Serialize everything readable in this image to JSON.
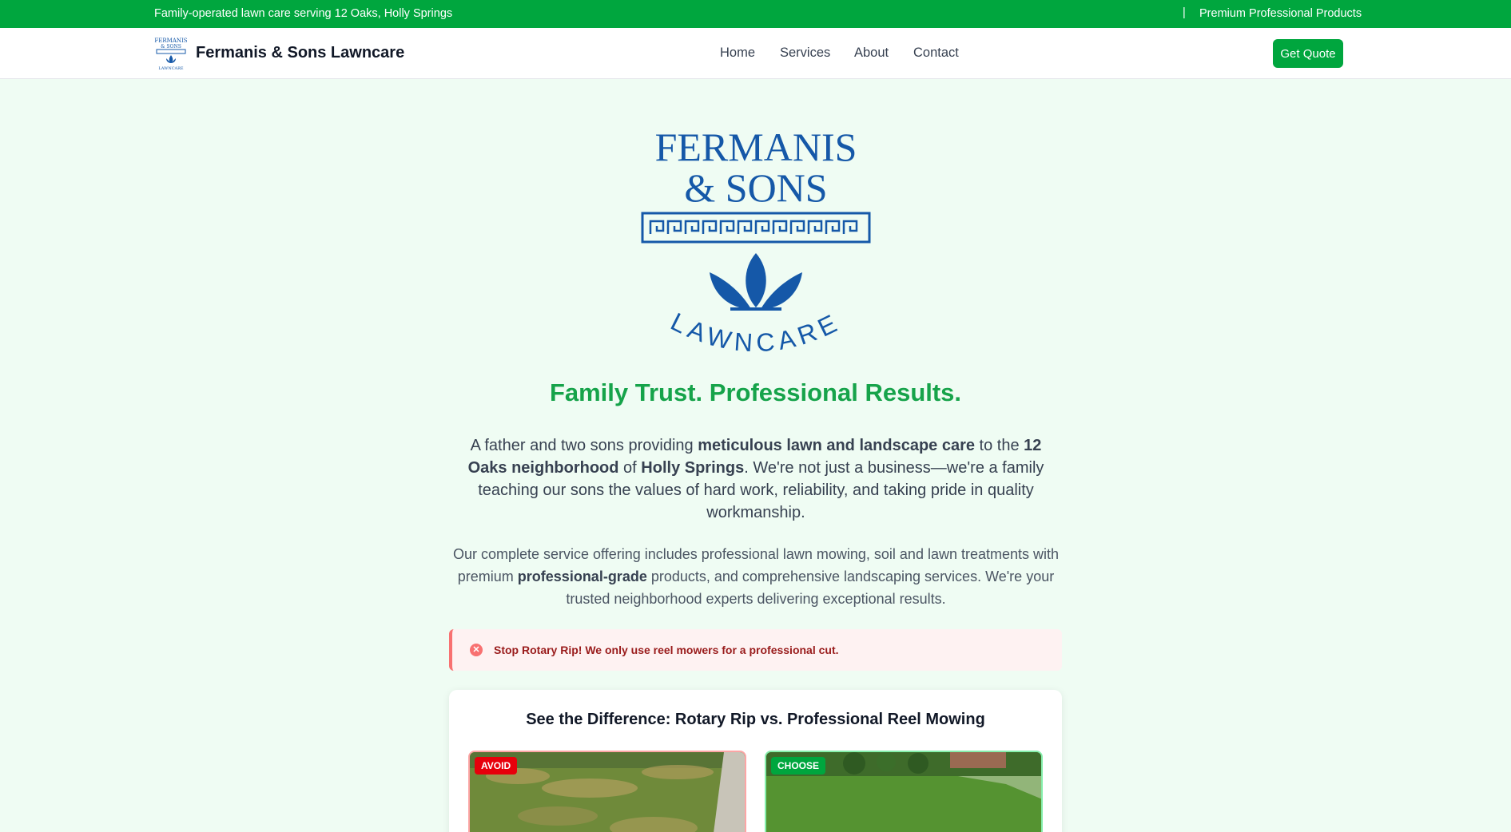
{
  "topbar": {
    "left_text": "Family-operated lawn care serving 12 Oaks, Holly Springs",
    "separator": "|",
    "right_text": "Premium Professional Products",
    "color": "#00a63e"
  },
  "navbar": {
    "brand_name": "Fermanis & Sons Lawncare",
    "links": [
      "Home",
      "Services",
      "About",
      "Contact"
    ],
    "cta_label": "Get Quote"
  },
  "logo": {
    "line1": "FERMANIS",
    "line2": "& SONS",
    "arc": "LAWNCARE",
    "color": "#1558a8"
  },
  "hero": {
    "headline": "Family Trust. Professional Results.",
    "p1": {
      "t1": "A father and two sons providing ",
      "b1": "meticulous lawn and landscape care",
      "t2": " to the ",
      "b2": "12 Oaks neighborhood",
      "t3": " of ",
      "b3": "Holly Springs",
      "t4": ". We're not just a business—we're a family teaching our sons the values of hard work, reliability, and taking pride in quality workmanship."
    },
    "p2": {
      "t1": "Our complete service offering includes professional lawn mowing, soil and lawn treatments with premium ",
      "b1": "professional-grade",
      "t2": " products, and comprehensive landscaping services. We're your trusted neighborhood experts delivering exceptional results."
    }
  },
  "alert": {
    "icon": "x-circle-icon",
    "text": "Stop Rotary Rip! We only use reel mowers for a professional cut."
  },
  "comparison": {
    "title": "See the Difference: Rotary Rip vs. Professional Reel Mowing",
    "left_badge": "AVOID",
    "right_badge": "CHOOSE"
  }
}
